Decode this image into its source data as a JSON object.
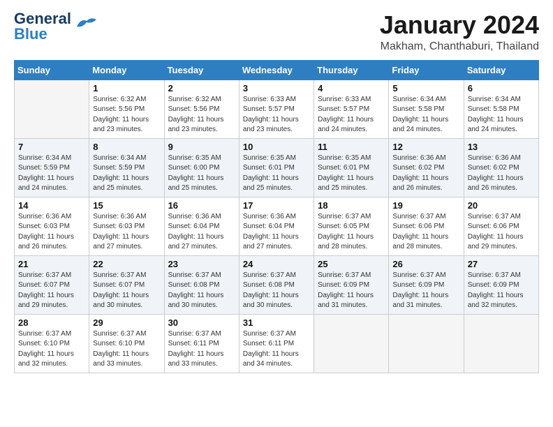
{
  "header": {
    "logo_line1": "General",
    "logo_line2": "Blue",
    "month": "January 2024",
    "location": "Makham, Chanthaburi, Thailand"
  },
  "weekdays": [
    "Sunday",
    "Monday",
    "Tuesday",
    "Wednesday",
    "Thursday",
    "Friday",
    "Saturday"
  ],
  "weeks": [
    [
      {
        "day": "",
        "empty": true
      },
      {
        "day": "1",
        "sunrise": "6:32 AM",
        "sunset": "5:56 PM",
        "daylight": "11 hours and 23 minutes."
      },
      {
        "day": "2",
        "sunrise": "6:32 AM",
        "sunset": "5:56 PM",
        "daylight": "11 hours and 23 minutes."
      },
      {
        "day": "3",
        "sunrise": "6:33 AM",
        "sunset": "5:57 PM",
        "daylight": "11 hours and 23 minutes."
      },
      {
        "day": "4",
        "sunrise": "6:33 AM",
        "sunset": "5:57 PM",
        "daylight": "11 hours and 24 minutes."
      },
      {
        "day": "5",
        "sunrise": "6:34 AM",
        "sunset": "5:58 PM",
        "daylight": "11 hours and 24 minutes."
      },
      {
        "day": "6",
        "sunrise": "6:34 AM",
        "sunset": "5:58 PM",
        "daylight": "11 hours and 24 minutes."
      }
    ],
    [
      {
        "day": "7",
        "sunrise": "6:34 AM",
        "sunset": "5:59 PM",
        "daylight": "11 hours and 24 minutes."
      },
      {
        "day": "8",
        "sunrise": "6:34 AM",
        "sunset": "5:59 PM",
        "daylight": "11 hours and 25 minutes."
      },
      {
        "day": "9",
        "sunrise": "6:35 AM",
        "sunset": "6:00 PM",
        "daylight": "11 hours and 25 minutes."
      },
      {
        "day": "10",
        "sunrise": "6:35 AM",
        "sunset": "6:01 PM",
        "daylight": "11 hours and 25 minutes."
      },
      {
        "day": "11",
        "sunrise": "6:35 AM",
        "sunset": "6:01 PM",
        "daylight": "11 hours and 25 minutes."
      },
      {
        "day": "12",
        "sunrise": "6:36 AM",
        "sunset": "6:02 PM",
        "daylight": "11 hours and 26 minutes."
      },
      {
        "day": "13",
        "sunrise": "6:36 AM",
        "sunset": "6:02 PM",
        "daylight": "11 hours and 26 minutes."
      }
    ],
    [
      {
        "day": "14",
        "sunrise": "6:36 AM",
        "sunset": "6:03 PM",
        "daylight": "11 hours and 26 minutes."
      },
      {
        "day": "15",
        "sunrise": "6:36 AM",
        "sunset": "6:03 PM",
        "daylight": "11 hours and 27 minutes."
      },
      {
        "day": "16",
        "sunrise": "6:36 AM",
        "sunset": "6:04 PM",
        "daylight": "11 hours and 27 minutes."
      },
      {
        "day": "17",
        "sunrise": "6:36 AM",
        "sunset": "6:04 PM",
        "daylight": "11 hours and 27 minutes."
      },
      {
        "day": "18",
        "sunrise": "6:37 AM",
        "sunset": "6:05 PM",
        "daylight": "11 hours and 28 minutes."
      },
      {
        "day": "19",
        "sunrise": "6:37 AM",
        "sunset": "6:06 PM",
        "daylight": "11 hours and 28 minutes."
      },
      {
        "day": "20",
        "sunrise": "6:37 AM",
        "sunset": "6:06 PM",
        "daylight": "11 hours and 29 minutes."
      }
    ],
    [
      {
        "day": "21",
        "sunrise": "6:37 AM",
        "sunset": "6:07 PM",
        "daylight": "11 hours and 29 minutes."
      },
      {
        "day": "22",
        "sunrise": "6:37 AM",
        "sunset": "6:07 PM",
        "daylight": "11 hours and 30 minutes."
      },
      {
        "day": "23",
        "sunrise": "6:37 AM",
        "sunset": "6:08 PM",
        "daylight": "11 hours and 30 minutes."
      },
      {
        "day": "24",
        "sunrise": "6:37 AM",
        "sunset": "6:08 PM",
        "daylight": "11 hours and 30 minutes."
      },
      {
        "day": "25",
        "sunrise": "6:37 AM",
        "sunset": "6:09 PM",
        "daylight": "11 hours and 31 minutes."
      },
      {
        "day": "26",
        "sunrise": "6:37 AM",
        "sunset": "6:09 PM",
        "daylight": "11 hours and 31 minutes."
      },
      {
        "day": "27",
        "sunrise": "6:37 AM",
        "sunset": "6:09 PM",
        "daylight": "11 hours and 32 minutes."
      }
    ],
    [
      {
        "day": "28",
        "sunrise": "6:37 AM",
        "sunset": "6:10 PM",
        "daylight": "11 hours and 32 minutes."
      },
      {
        "day": "29",
        "sunrise": "6:37 AM",
        "sunset": "6:10 PM",
        "daylight": "11 hours and 33 minutes."
      },
      {
        "day": "30",
        "sunrise": "6:37 AM",
        "sunset": "6:11 PM",
        "daylight": "11 hours and 33 minutes."
      },
      {
        "day": "31",
        "sunrise": "6:37 AM",
        "sunset": "6:11 PM",
        "daylight": "11 hours and 34 minutes."
      },
      {
        "day": "",
        "empty": true
      },
      {
        "day": "",
        "empty": true
      },
      {
        "day": "",
        "empty": true
      }
    ]
  ]
}
